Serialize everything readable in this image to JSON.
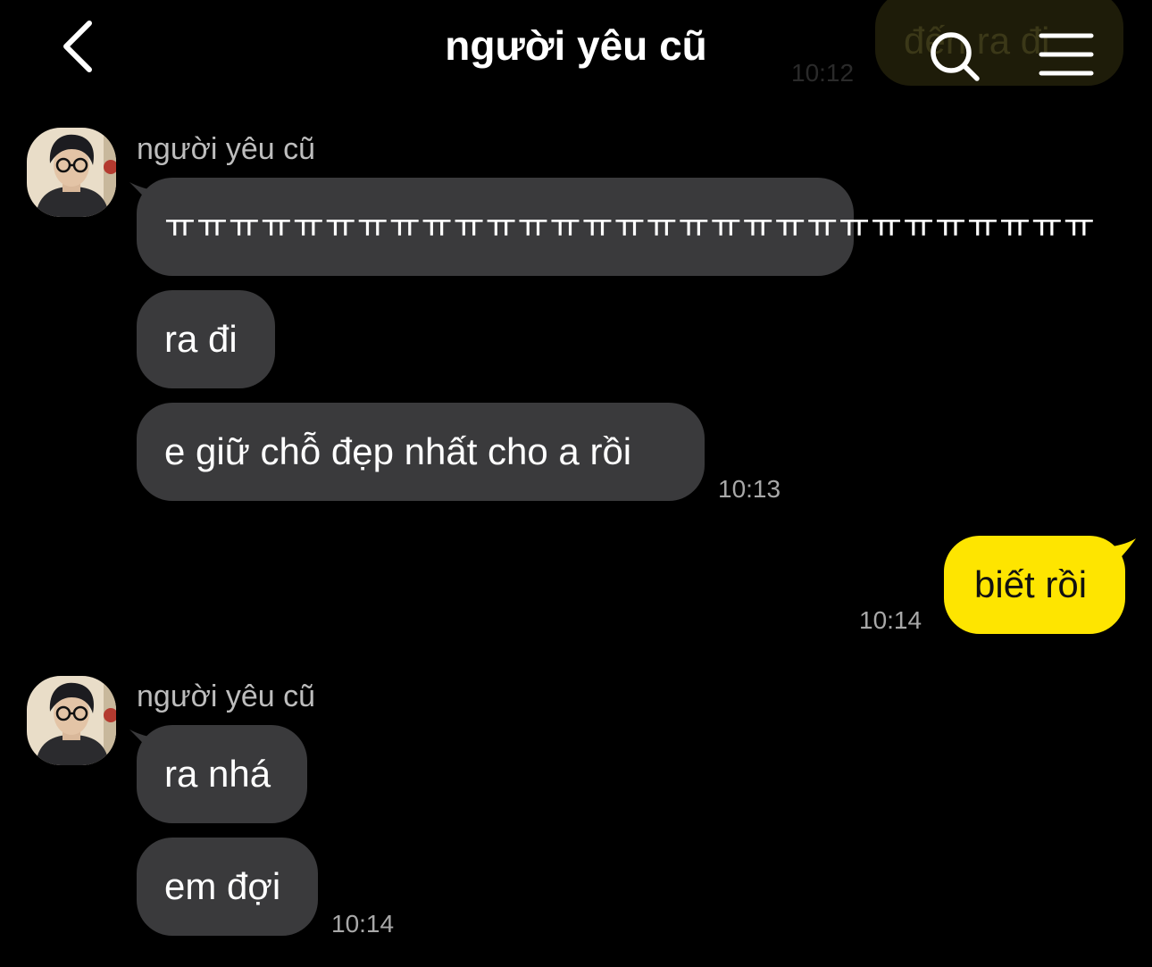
{
  "header": {
    "title": "người yêu cũ",
    "back_icon": "chevron-left-icon",
    "search_icon": "search-icon",
    "menu_icon": "menu-icon"
  },
  "previous": {
    "text": "đến ra đi",
    "time": "10:12"
  },
  "colors": {
    "background": "#000000",
    "incoming_bubble": "#3a3a3c",
    "outgoing_bubble": "#fee500",
    "timestamp": "#a8a8a8"
  },
  "groups": [
    {
      "sender": "người yêu cũ",
      "messages": [
        {
          "text": "ㅠㅠㅠㅠㅠㅠㅠㅠㅠㅠㅠㅠㅠㅠㅠㅠㅠㅠㅠㅠㅠㅠㅠㅠㅠㅠㅠㅠㅠ"
        },
        {
          "text": "ra đi"
        },
        {
          "text": "e giữ chỗ đẹp nhất cho a rồi"
        }
      ],
      "time": "10:13"
    },
    {
      "sender": "me",
      "messages": [
        {
          "text": "biết rồi"
        }
      ],
      "time": "10:14"
    },
    {
      "sender": "người yêu cũ",
      "messages": [
        {
          "text": "ra nhá"
        },
        {
          "text": "em đợi"
        }
      ],
      "time": "10:14"
    }
  ]
}
